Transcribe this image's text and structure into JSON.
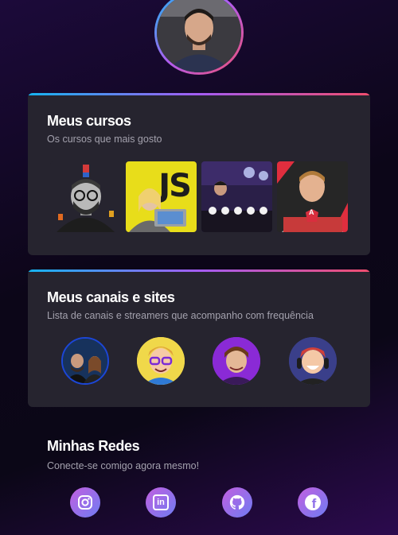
{
  "profile": {
    "photo_icon": "profile-photo"
  },
  "courses": {
    "title": "Meus cursos",
    "subtitle": "Os cursos que mais gosto",
    "items": [
      {
        "name": "course-react-instructor",
        "icon": "instructor-avatar"
      },
      {
        "name": "course-javascript",
        "badge": "JS"
      },
      {
        "name": "course-stage-event",
        "icon": "stage-photo"
      },
      {
        "name": "course-angular",
        "badge": "A"
      }
    ]
  },
  "channels": {
    "title": "Meus canais e sites",
    "subtitle": "Lista de canais e streamers que acompanho com frequência",
    "items": [
      {
        "name": "channel-couple"
      },
      {
        "name": "channel-cartoon-glasses"
      },
      {
        "name": "channel-purple-streamer"
      },
      {
        "name": "channel-gamer-cartoon"
      }
    ]
  },
  "social": {
    "title": "Minhas Redes",
    "subtitle": "Conecte-se comigo agora mesmo!",
    "items": [
      {
        "name": "instagram",
        "icon": "instagram-icon"
      },
      {
        "name": "linkedin",
        "icon": "linkedin-icon",
        "glyph": "in"
      },
      {
        "name": "github",
        "icon": "github-icon"
      },
      {
        "name": "facebook",
        "icon": "facebook-icon",
        "glyph": "f"
      }
    ]
  },
  "colors": {
    "accent_blue": "#15b4f0",
    "accent_purple": "#a45cf2",
    "accent_red": "#f04d6e",
    "card_bg": "#26242f"
  }
}
